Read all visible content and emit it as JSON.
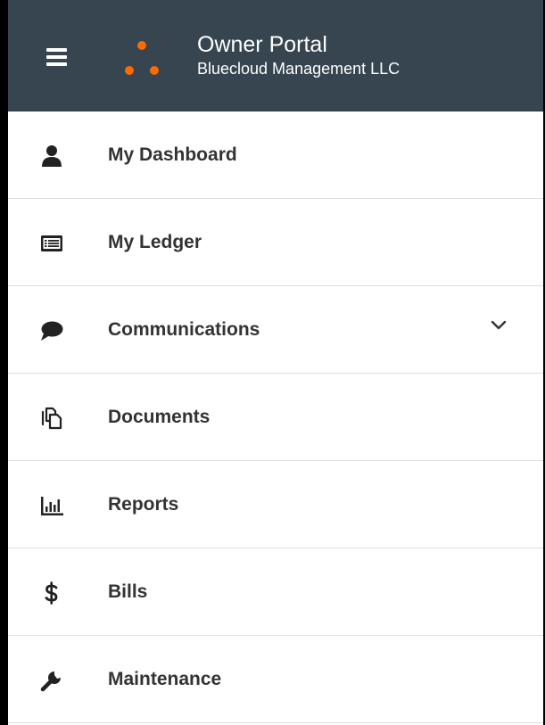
{
  "header": {
    "menu_icon": "hamburger-menu-icon",
    "logo_icon": "three-dot-logo-icon",
    "title": "Owner Portal",
    "subtitle": "Bluecloud Management LLC",
    "background_color": "#36454f",
    "accent_color": "#ff6a00"
  },
  "nav": {
    "items": [
      {
        "label": "My Dashboard",
        "icon": "user-icon"
      },
      {
        "label": "My Ledger",
        "icon": "ledger-icon"
      },
      {
        "label": "Communications",
        "icon": "speech-bubble-icon",
        "expand_icon": "chevron-down-icon"
      },
      {
        "label": "Documents",
        "icon": "documents-icon"
      },
      {
        "label": "Reports",
        "icon": "bar-chart-icon"
      },
      {
        "label": "Bills",
        "icon": "dollar-icon"
      },
      {
        "label": "Maintenance",
        "icon": "wrench-icon"
      }
    ]
  }
}
